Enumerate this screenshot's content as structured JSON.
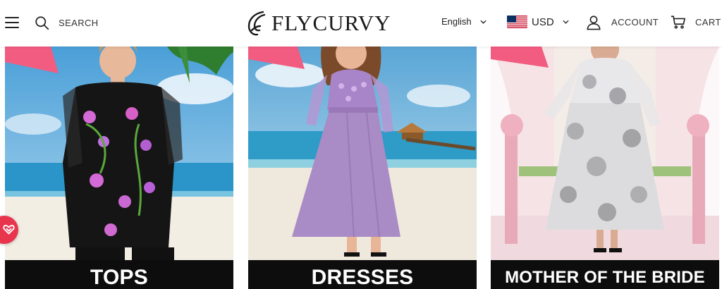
{
  "header": {
    "search_label": "SEARCH",
    "brand_name": "FLYCURVY",
    "language": "English",
    "currency": "USD",
    "account_label": "ACCOUNT",
    "cart_label": "CART"
  },
  "categories": [
    {
      "label": "TOPS",
      "image_icon": "model-floral-top-beach-photo"
    },
    {
      "label": "DRESSES",
      "image_icon": "model-lavender-dress-beach-photo"
    },
    {
      "label": "MOTHER OF THE BRIDE",
      "image_icon": "model-floral-gown-wedding-photo"
    }
  ],
  "icons": {
    "menu": "hamburger-menu-icon",
    "search": "search-icon",
    "flag": "us-flag-icon",
    "account": "user-icon",
    "cart": "cart-icon",
    "floating": "heart-badge-icon"
  },
  "colors": {
    "accent_pink": "#f25c80",
    "badge_red": "#e8354d",
    "label_bar": "#0d0d0d",
    "header_bg": "#ffffff"
  }
}
